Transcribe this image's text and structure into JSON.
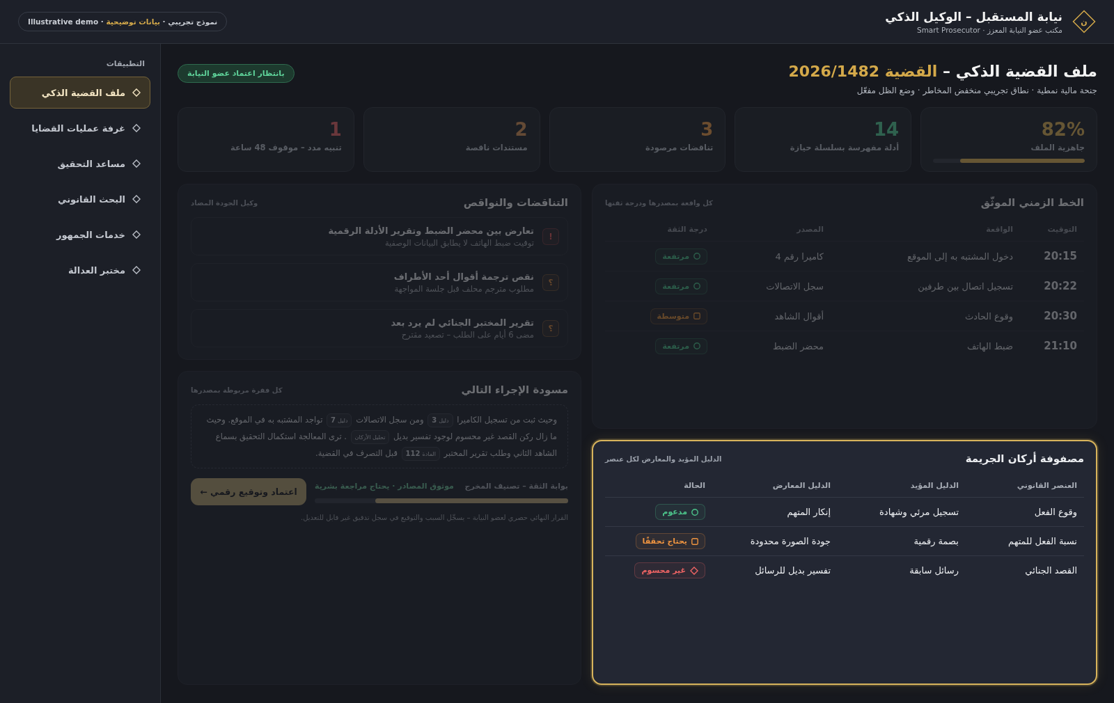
{
  "header": {
    "logo_letter": "ن",
    "title": "نيابة المستقبل – الوكيل الذكي",
    "subtitle": "مكتب عضو النيابة المعزز · Smart Prosecutor",
    "demo_notice": "نموذج تجريبي · **بيانات توضيحية** · Illustrative demo"
  },
  "sidebar": {
    "heading": "التطبيقات",
    "items": [
      {
        "label": "ملف القضية الذكي",
        "selected": true
      },
      {
        "label": "غرفة عمليات القضايا",
        "selected": false
      },
      {
        "label": "مساعد التحقيق",
        "selected": false
      },
      {
        "label": "البحث القانوني",
        "selected": false
      },
      {
        "label": "خدمات الجمهور",
        "selected": false
      },
      {
        "label": "مختبر العدالة",
        "selected": false
      }
    ]
  },
  "case": {
    "title": "ملف القضية الذكي –",
    "case_number": "القضية 2026/1482",
    "subtitle": "جنحة مالية نمطية · نطاق تجريبي منخفض المخاطر · وضع الظل مفعّل",
    "status": "بانتظار اعتماد عضو النيابة"
  },
  "kpis": [
    {
      "value": "82%",
      "label": "جاهزية الملف",
      "color": "#665634",
      "level": 0.82
    },
    {
      "value": "14",
      "label": "أدلة مفهرسة بسلسلة حيازة",
      "color": "#2f614e"
    },
    {
      "value": "3",
      "label": "تناقضات مرصودة",
      "color": "#6c4d2f"
    },
    {
      "value": "2",
      "label": "مستندات ناقصة",
      "color": "#644a35"
    },
    {
      "value": "1",
      "label": "تنبيه مدد – موقوف 48 ساعة",
      "color": "#6a373b"
    }
  ],
  "timeline": {
    "title": "الخط الزمني الموثّق",
    "subtitle": "كل واقعة بمصدرها ودرجة ثقتها",
    "focused": false,
    "columns": [
      "التوقيت",
      "الواقعة",
      "المصدر",
      "درجة الثقة"
    ],
    "rows": [
      {
        "time": "20:15",
        "event": "دخول المشتبه به إلى الموقع",
        "source": "كاميرا رقم 4",
        "confidence": {
          "label": "مرتفعة",
          "kind": "high"
        }
      },
      {
        "time": "20:22",
        "event": "تسجيل اتصال بين طرفين",
        "source": "سجل الاتصالات",
        "confidence": {
          "label": "مرتفعة",
          "kind": "high"
        }
      },
      {
        "time": "20:30",
        "event": "وقوع الحادث",
        "source": "أقوال الشاهد",
        "confidence": {
          "label": "متوسطة",
          "kind": "medium"
        }
      },
      {
        "time": "21:10",
        "event": "ضبط الهاتف",
        "source": "محضر الضبط",
        "confidence": {
          "label": "مرتفعة",
          "kind": "high"
        }
      }
    ]
  },
  "issues": {
    "title": "التناقضات والنواقص",
    "subtitle": "وكيل الجودة المضاد",
    "focused": false,
    "items": [
      {
        "kind": "contradiction",
        "marker": "!",
        "title": "تعارض بين محضر الضبط وتقرير الأدلة الرقمية",
        "detail": "توقيت ضبط الهاتف لا يطابق البيانات الوصفية"
      },
      {
        "kind": "gap",
        "marker": "؟",
        "title": "نقص ترجمة أقوال أحد الأطراف",
        "detail": "مطلوب مترجم محلف قبل جلسة المواجهة"
      },
      {
        "kind": "gap",
        "marker": "؟",
        "title": "تقرير المختبر الجنائي لم يرد بعد",
        "detail": "مضى 6 أيام على الطلب – تصعيد مقترح"
      }
    ]
  },
  "matrix": {
    "title": "مصفوفة أركان الجريمة",
    "subtitle": "الدليل المؤيد والمعارض لكل عنصر",
    "focused": true,
    "columns": [
      "العنصر القانوني",
      "الدليل المؤيد",
      "الدليل المعارض",
      "الحالة"
    ],
    "rows": [
      {
        "element": "وقوع الفعل",
        "supporting": "تسجيل مرئي وشهادة",
        "opposing": "إنكار المتهم",
        "status": {
          "label": "مدعوم",
          "kind": "supported"
        }
      },
      {
        "element": "نسبة الفعل للمتهم",
        "supporting": "بصمة رقمية",
        "opposing": "جودة الصورة محدودة",
        "status": {
          "label": "يحتاج تحققًا",
          "kind": "needs_check"
        }
      },
      {
        "element": "القصد الجنائي",
        "supporting": "رسائل سابقة",
        "opposing": "تفسير بديل للرسائل",
        "status": {
          "label": "غير محسوم",
          "kind": "undetermined"
        }
      }
    ]
  },
  "draft": {
    "title": "مسودة الإجراء التالي",
    "subtitle": "كل فقرة مربوطة بمصدرها",
    "focused": false,
    "paragraph": [
      {
        "kind": "text",
        "text": "وحيث ثبت من تسجيل الكاميرا"
      },
      {
        "kind": "ref",
        "label": "دليل",
        "number": "3"
      },
      {
        "kind": "text",
        "text": "ومن سجل الاتصالات"
      },
      {
        "kind": "ref",
        "label": "دليل",
        "number": "7"
      },
      {
        "kind": "text",
        "text": "تواجد المشتبه به في الموقع. وحيث ما زال ركن القصد غير محسوم لوجود تفسير بديل"
      },
      {
        "kind": "ref",
        "label": "تحليل الأركان"
      },
      {
        "kind": "text",
        "text": ". ترى المعالجة استكمال التحقيق بسماع الشاهد الثاني وطلب تقرير المختبر"
      },
      {
        "kind": "ref",
        "label": "المادة",
        "number": "112"
      },
      {
        "kind": "text",
        "text": "قبل التصرف في القضية."
      }
    ],
    "gate": {
      "label": "بوابة الثقة – تصنيف المخرج",
      "verdict": "موثوق المصادر · يحتاج مراجعة بشرية",
      "level": 0.76
    },
    "action_button": "اعتماد وتوقيع رقمي ←",
    "note": "القرار النهائي حصري لعضو النيابة – يسجِّل السبب والتوقيع في سجل تدقيق غير قابل للتعديل."
  }
}
